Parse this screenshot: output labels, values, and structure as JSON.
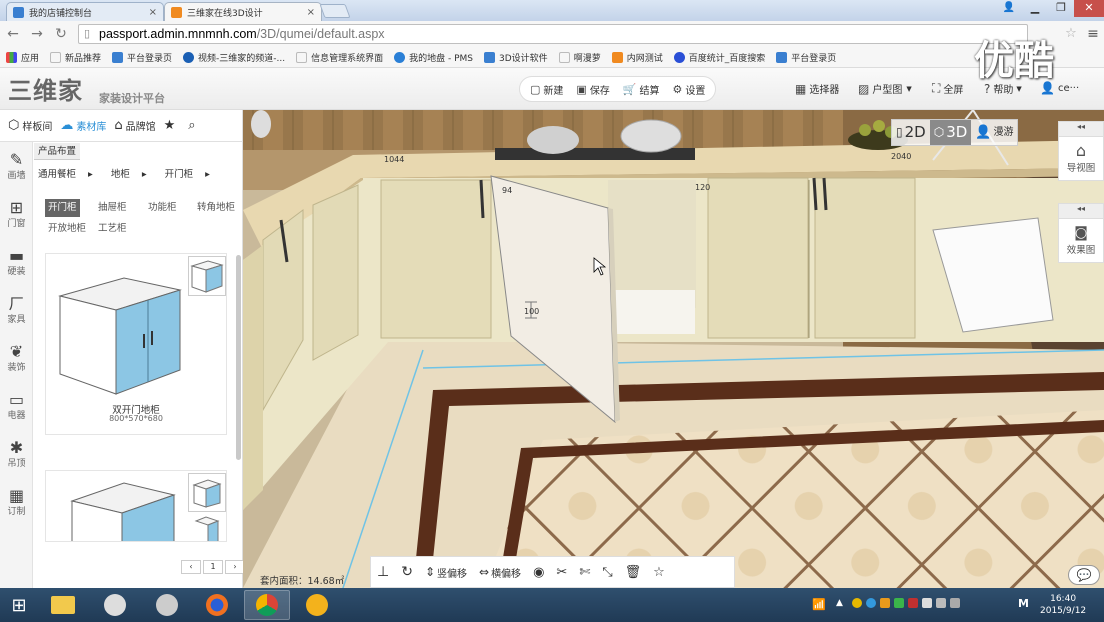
{
  "browser": {
    "tabs": [
      {
        "title": "我的店铺控制台",
        "close": "×"
      },
      {
        "title": "三维家在线3D设计",
        "close": "×"
      }
    ],
    "url_domain": "passport.admin.mnmnh.com",
    "url_path": "/3D/qumei/default.aspx",
    "bookmarks": [
      "应用",
      "新品推荐",
      "平台登录页",
      "视频-三维家的频道-...",
      "信息管理系统界面",
      "我的地盘 - PMS",
      "3D设计软件",
      "啊漫萝",
      "内网测试",
      "百度统计_百度搜索",
      "平台登录页"
    ]
  },
  "watermark": "优酷",
  "header": {
    "logo": "三维家",
    "tagline": "家装设计平台",
    "toolbar": {
      "new": "新建",
      "save": "保存",
      "checkout": "结算",
      "settings": "设置"
    },
    "selector": "选择器",
    "floorplan": "户型图",
    "fullscreen": "全屏",
    "help": "帮助",
    "user": "ce···"
  },
  "left_panel": {
    "tabs": {
      "samples": "样板间",
      "materials": "素材库",
      "brands": "品牌馆"
    },
    "side": [
      "画墙",
      "门窗",
      "硬装",
      "家具",
      "装饰",
      "电器",
      "吊顶",
      "订制"
    ],
    "heading": "产品布置",
    "crumbs": [
      "通用餐柜",
      "地柜",
      "开门柜"
    ],
    "categories": [
      "开门柜",
      "抽屉柜",
      "功能柜",
      "转角地柜",
      "开放地柜",
      "工艺柜"
    ],
    "selected_category": "开门柜",
    "products": [
      {
        "name": "双开门地柜",
        "size": "800*570*680"
      }
    ],
    "page": "1",
    "prev": "‹",
    "next": "›"
  },
  "viewport": {
    "dims": {
      "a": "1044",
      "b": "94",
      "c": "120",
      "d": "2040",
      "e": "100"
    },
    "modes": {
      "d2": "2D",
      "d3": "3D",
      "walk": "漫游"
    },
    "right": {
      "nav": "导视图",
      "effect": "效果图"
    },
    "area_label": "套内面积：14.68㎡",
    "bottom": {
      "vertical": "竖偏移",
      "horizontal": "横偏移"
    }
  },
  "taskbar": {
    "time": "16:40",
    "date": "2015/9/12",
    "ime": "M"
  },
  "colors": {
    "accent_blue": "#2a8fd6",
    "cabinet": "#ece6c8",
    "door_blue": "#8cc6e4"
  }
}
